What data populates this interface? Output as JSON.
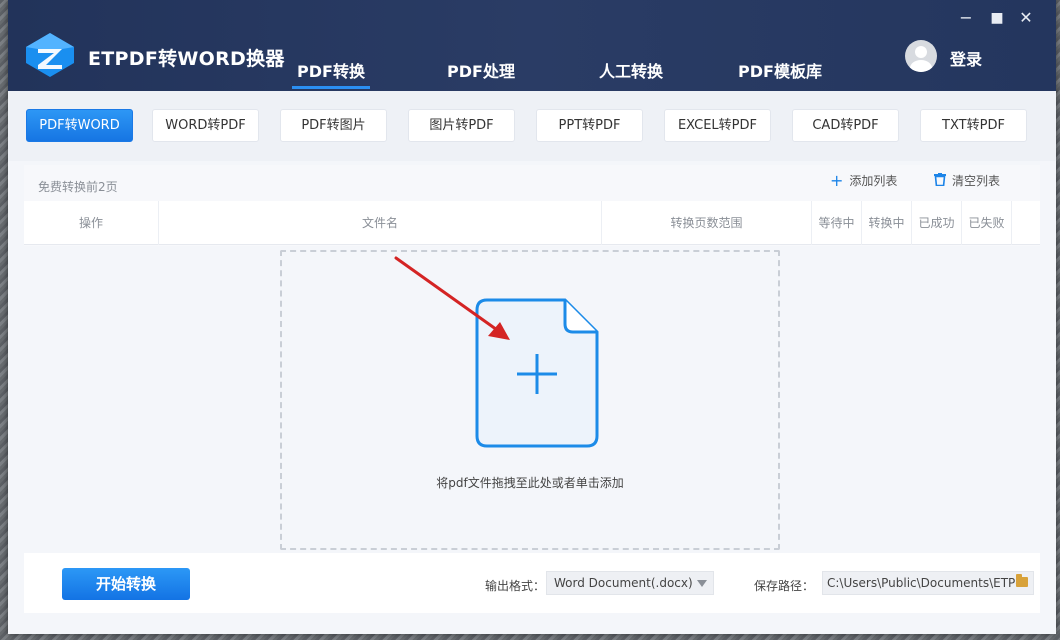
{
  "window": {
    "app_title": "ETPDF转WORD换器",
    "controls": {
      "minimize": "−",
      "maximize": "■",
      "close": "✕"
    }
  },
  "main_nav": [
    {
      "label": "PDF转换",
      "active": true
    },
    {
      "label": "PDF处理",
      "active": false
    },
    {
      "label": "人工转换",
      "active": false
    },
    {
      "label": "PDF模板库",
      "active": false
    }
  ],
  "user": {
    "login_label": "登录"
  },
  "sub_tabs": [
    {
      "label": "PDF转WORD",
      "active": true
    },
    {
      "label": "WORD转PDF",
      "active": false
    },
    {
      "label": "PDF转图片",
      "active": false
    },
    {
      "label": "图片转PDF",
      "active": false
    },
    {
      "label": "PPT转PDF",
      "active": false
    },
    {
      "label": "EXCEL转PDF",
      "active": false
    },
    {
      "label": "CAD转PDF",
      "active": false
    },
    {
      "label": "TXT转PDF",
      "active": false
    }
  ],
  "list": {
    "free_note": "免费转换前2页",
    "add_label": "添加列表",
    "clear_label": "清空列表",
    "columns": [
      "操作",
      "文件名",
      "转换页数范围",
      "等待中",
      "转换中",
      "已成功",
      "已失败"
    ],
    "drop_text": "将pdf文件拖拽至此处或者单击添加"
  },
  "footer": {
    "start_label": "开始转换",
    "format_label": "输出格式：",
    "format_value": "Word Document(.docx)",
    "path_label": "保存路径：",
    "path_value": "C:\\Users\\Public\\Documents\\ETPdf"
  },
  "colors": {
    "titlebar": "#24365e",
    "accent": "#1c84e8",
    "arrow": "#d42424"
  }
}
